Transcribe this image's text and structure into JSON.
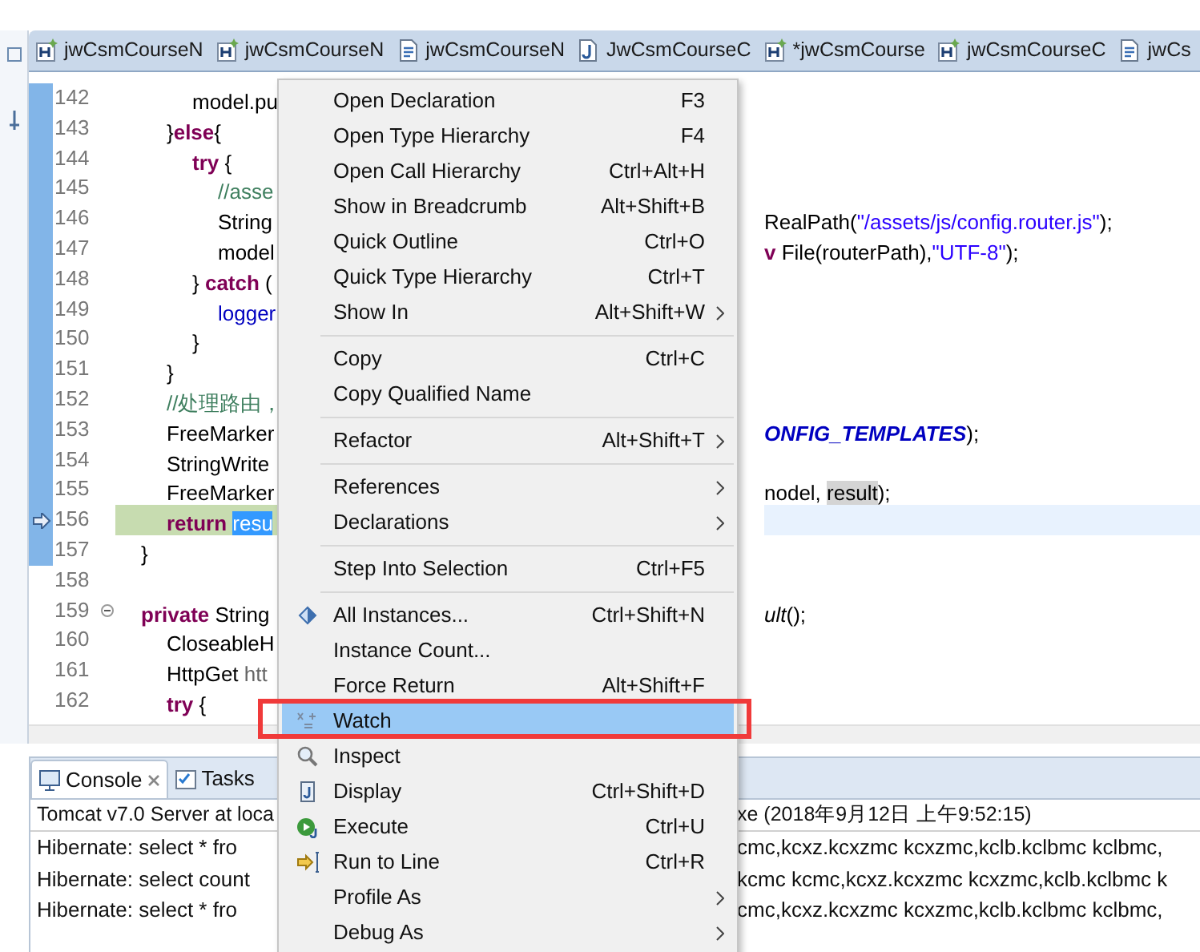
{
  "editor_tabs": [
    {
      "label": "jwCsmCourseN",
      "kind": "html"
    },
    {
      "label": "jwCsmCourseN",
      "kind": "html"
    },
    {
      "label": "jwCsmCourseN",
      "kind": "script"
    },
    {
      "label": "JwCsmCourseC",
      "kind": "java"
    },
    {
      "label": "*jwCsmCourse",
      "kind": "html"
    },
    {
      "label": "jwCsmCourseC",
      "kind": "html"
    },
    {
      "label": "jwCs",
      "kind": "script"
    }
  ],
  "code_lines": [
    {
      "number": "142",
      "current": false,
      "instruction_pointer": false,
      "foldable": false,
      "left": [
        {
          "text": "\t\t\tmodel.pu",
          "kind": "plain"
        }
      ]
    },
    {
      "number": "143",
      "current": false,
      "instruction_pointer": false,
      "foldable": false,
      "left": [
        {
          "text": "\t\t}",
          "kind": "plain"
        },
        {
          "text": "else",
          "kind": "keyword"
        },
        {
          "text": "{",
          "kind": "plain"
        }
      ]
    },
    {
      "number": "144",
      "current": false,
      "instruction_pointer": false,
      "foldable": false,
      "left": [
        {
          "text": "\t\t\ttry",
          "kind": "keyword"
        },
        {
          "text": " {",
          "kind": "plain"
        }
      ]
    },
    {
      "number": "145",
      "current": false,
      "instruction_pointer": false,
      "foldable": false,
      "left": [
        {
          "text": "\t\t\t\t//asse",
          "kind": "comment"
        }
      ]
    },
    {
      "number": "146",
      "current": false,
      "instruction_pointer": false,
      "foldable": false,
      "left": [
        {
          "text": "\t\t\t\tString",
          "kind": "plain"
        }
      ],
      "right": [
        {
          "text": "RealPath(",
          "kind": "plain"
        },
        {
          "text": "\"/assets/js/config.router.js\"",
          "kind": "string"
        },
        {
          "text": ");",
          "kind": "plain"
        }
      ]
    },
    {
      "number": "147",
      "current": false,
      "instruction_pointer": false,
      "foldable": false,
      "left": [
        {
          "text": "\t\t\t\tmodel",
          "kind": "plain"
        }
      ],
      "right": [
        {
          "text": "v",
          "kind": "keyword"
        },
        {
          "text": " File(routerPath),",
          "kind": "plain"
        },
        {
          "text": "\"UTF-8\"",
          "kind": "string"
        },
        {
          "text": ");",
          "kind": "plain"
        }
      ]
    },
    {
      "number": "148",
      "current": false,
      "instruction_pointer": false,
      "foldable": false,
      "left": [
        {
          "text": "\t\t\t} ",
          "kind": "plain"
        },
        {
          "text": "catch",
          "kind": "keyword"
        },
        {
          "text": " (",
          "kind": "plain"
        }
      ]
    },
    {
      "number": "149",
      "current": false,
      "instruction_pointer": false,
      "foldable": false,
      "left": [
        {
          "text": "\t\t\t\tlogger",
          "kind": "field"
        }
      ]
    },
    {
      "number": "150",
      "current": false,
      "instruction_pointer": false,
      "foldable": false,
      "left": [
        {
          "text": "\t\t\t}",
          "kind": "plain"
        }
      ]
    },
    {
      "number": "151",
      "current": false,
      "instruction_pointer": false,
      "foldable": false,
      "left": [
        {
          "text": "\t\t}",
          "kind": "plain"
        }
      ]
    },
    {
      "number": "152",
      "current": false,
      "instruction_pointer": false,
      "foldable": false,
      "left": [
        {
          "text": "\t\t//处理路由，",
          "kind": "comment"
        }
      ]
    },
    {
      "number": "153",
      "current": false,
      "instruction_pointer": false,
      "foldable": false,
      "left": [
        {
          "text": "\t\tFreeMarker",
          "kind": "plain"
        }
      ],
      "right": [
        {
          "text": "ONFIG_TEMPLATES",
          "kind": "constant"
        },
        {
          "text": ");",
          "kind": "plain"
        }
      ]
    },
    {
      "number": "154",
      "current": false,
      "instruction_pointer": false,
      "foldable": false,
      "left": [
        {
          "text": "\t\tStringWrite",
          "kind": "plain"
        }
      ]
    },
    {
      "number": "155",
      "current": false,
      "instruction_pointer": false,
      "foldable": false,
      "left": [
        {
          "text": "\t\tFreeMarker",
          "kind": "plain"
        }
      ],
      "right": [
        {
          "text": "nodel, ",
          "kind": "plain"
        },
        {
          "text": "result",
          "kind": "occurrence"
        },
        {
          "text": ");",
          "kind": "plain"
        }
      ]
    },
    {
      "number": "156",
      "current": true,
      "instruction_pointer": true,
      "foldable": false,
      "left": [
        {
          "text": "\t\treturn ",
          "kind": "keyword"
        },
        {
          "text": "resu",
          "kind": "selection"
        }
      ]
    },
    {
      "number": "157",
      "current": false,
      "instruction_pointer": false,
      "foldable": false,
      "left": [
        {
          "text": "\t}",
          "kind": "plain"
        }
      ]
    },
    {
      "number": "158",
      "current": false,
      "instruction_pointer": false,
      "foldable": false
    },
    {
      "number": "159",
      "current": false,
      "instruction_pointer": false,
      "foldable": true,
      "left": [
        {
          "text": "\tprivate",
          "kind": "keyword"
        },
        {
          "text": " String",
          "kind": "plain"
        }
      ],
      "right": [
        {
          "text": "ult",
          "kind": "italic"
        },
        {
          "text": "();",
          "kind": "plain"
        }
      ]
    },
    {
      "number": "160",
      "current": false,
      "instruction_pointer": false,
      "foldable": false,
      "left": [
        {
          "text": "\t\tCloseableH",
          "kind": "plain"
        }
      ]
    },
    {
      "number": "161",
      "current": false,
      "instruction_pointer": false,
      "foldable": false,
      "left": [
        {
          "text": "\t\tHttpGet ",
          "kind": "plain"
        },
        {
          "text": "htt",
          "kind": "unused"
        }
      ]
    },
    {
      "number": "162",
      "current": false,
      "instruction_pointer": false,
      "foldable": false,
      "left": [
        {
          "text": "\t\ttry",
          "kind": "keyword"
        },
        {
          "text": " {",
          "kind": "plain"
        }
      ]
    }
  ],
  "context_menu": {
    "items": [
      {
        "kind": "item",
        "label": "Open Declaration",
        "shortcut": "F3",
        "submenu": false,
        "selected": false
      },
      {
        "kind": "item",
        "label": "Open Type Hierarchy",
        "shortcut": "F4",
        "submenu": false,
        "selected": false
      },
      {
        "kind": "item",
        "label": "Open Call Hierarchy",
        "shortcut": "Ctrl+Alt+H",
        "submenu": false,
        "selected": false
      },
      {
        "kind": "item",
        "label": "Show in Breadcrumb",
        "shortcut": "Alt+Shift+B",
        "submenu": false,
        "selected": false
      },
      {
        "kind": "item",
        "label": "Quick Outline",
        "shortcut": "Ctrl+O",
        "submenu": false,
        "selected": false
      },
      {
        "kind": "item",
        "label": "Quick Type Hierarchy",
        "shortcut": "Ctrl+T",
        "submenu": false,
        "selected": false
      },
      {
        "kind": "item",
        "label": "Show In",
        "shortcut": "Alt+Shift+W",
        "submenu": true,
        "selected": false
      },
      {
        "kind": "separator"
      },
      {
        "kind": "item",
        "label": "Copy",
        "shortcut": "Ctrl+C",
        "submenu": false,
        "selected": false
      },
      {
        "kind": "item",
        "label": "Copy Qualified Name",
        "submenu": false,
        "selected": false
      },
      {
        "kind": "separator"
      },
      {
        "kind": "item",
        "label": "Refactor",
        "shortcut": "Alt+Shift+T",
        "submenu": true,
        "selected": false
      },
      {
        "kind": "separator"
      },
      {
        "kind": "item",
        "label": "References",
        "submenu": true,
        "selected": false
      },
      {
        "kind": "item",
        "label": "Declarations",
        "submenu": true,
        "selected": false
      },
      {
        "kind": "separator"
      },
      {
        "kind": "item",
        "label": "Step Into Selection",
        "shortcut": "Ctrl+F5",
        "submenu": false,
        "selected": false
      },
      {
        "kind": "separator"
      },
      {
        "kind": "instances",
        "label": "All Instances...",
        "shortcut": "Ctrl+Shift+N",
        "submenu": false,
        "selected": false
      },
      {
        "kind": "item",
        "label": "Instance Count...",
        "submenu": false,
        "selected": false
      },
      {
        "kind": "item",
        "label": "Force Return",
        "shortcut": "Alt+Shift+F",
        "submenu": false,
        "selected": false
      },
      {
        "kind": "watch",
        "label": "Watch",
        "submenu": false,
        "selected": true
      },
      {
        "kind": "inspect",
        "label": "Inspect",
        "submenu": false,
        "selected": false
      },
      {
        "kind": "display",
        "label": "Display",
        "shortcut": "Ctrl+Shift+D",
        "submenu": false,
        "selected": false
      },
      {
        "kind": "execute",
        "label": "Execute",
        "shortcut": "Ctrl+U",
        "submenu": false,
        "selected": false
      },
      {
        "kind": "run-to-line",
        "label": "Run to Line",
        "shortcut": "Ctrl+R",
        "submenu": false,
        "selected": false
      },
      {
        "kind": "item",
        "label": "Profile As",
        "submenu": true,
        "selected": false
      },
      {
        "kind": "item",
        "label": "Debug As",
        "submenu": true,
        "selected": false
      }
    ]
  },
  "annotation": {
    "kind": "red-frame"
  },
  "console": {
    "tabs": [
      {
        "label": "Console",
        "selected": true,
        "closable": true
      },
      {
        "label": "Tasks",
        "selected": false,
        "closable": false
      }
    ],
    "description_left": "Tomcat v7.0 Server at loca",
    "description_right": "xe (2018年9月12日 上午9:52:15)",
    "lines": [
      {
        "left": "Hibernate: select * fro",
        "right": "cmc,kcxz.kcxzmc kcxzmc,kclb.kclbmc kclbmc,"
      },
      {
        "left": "Hibernate: select count",
        "right": "kcmc kcmc,kcxz.kcxzmc kcxzmc,kclb.kclbmc k"
      },
      {
        "left": "Hibernate: select * fro",
        "right": "cmc,kcxz.kcxzmc kcxzmc,kclb.kclbmc kclbmc,"
      }
    ]
  }
}
